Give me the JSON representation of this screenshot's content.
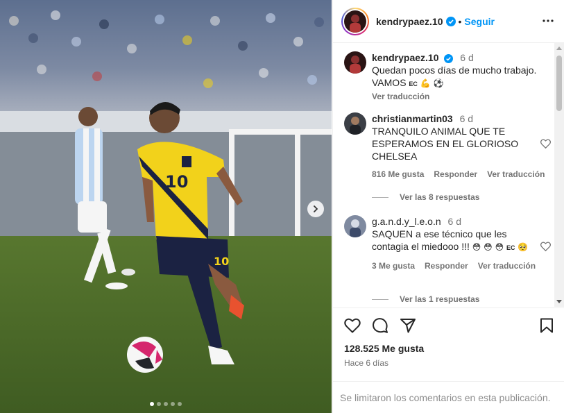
{
  "post": {
    "username": "kendrypaez.10",
    "follow_label": "Seguir",
    "likes": "128.525 Me gusta",
    "time_ago": "Hace 6 días",
    "comments_disabled_text": "Se limitaron los comentarios en esta publicación.",
    "carousel": {
      "slides": 5,
      "active_index": 0
    }
  },
  "caption": {
    "username": "kendrypaez.10",
    "time": "6 d",
    "line1": "Quedan pocos días de mucho trabajo.",
    "line2": "VAMOS",
    "flag_code": "EC",
    "translate": "Ver traducción"
  },
  "comments": [
    {
      "username": "christianmartin03",
      "time": "6 d",
      "text": "TRANQUILO ANIMAL QUE TE ESPERAMOS EN EL GLORIOSO CHELSEA",
      "likes": "816 Me gusta",
      "reply": "Responder",
      "translate": "Ver traducción",
      "view_replies": "Ver las 8 respuestas"
    },
    {
      "username": "g.a.n.d.y_l.e.o.n",
      "time": "6 d",
      "text": "SAQUEN a ese técnico que les contagia el miedooo !!!",
      "flag_code": "EC",
      "likes": "3 Me gusta",
      "reply": "Responder",
      "translate": "Ver traducción",
      "view_replies": "Ver las 1 respuestas"
    }
  ],
  "colors": {
    "accent": "#0095f6",
    "verified": "#0095f6",
    "jersey_yellow": "#f2d21b",
    "shorts_navy": "#1b2242",
    "pitch": "#4d6b2c"
  },
  "icons": [
    "more-icon",
    "verified-icon",
    "heart-icon",
    "comment-icon",
    "share-icon",
    "bookmark-icon",
    "chevron-right-icon"
  ]
}
